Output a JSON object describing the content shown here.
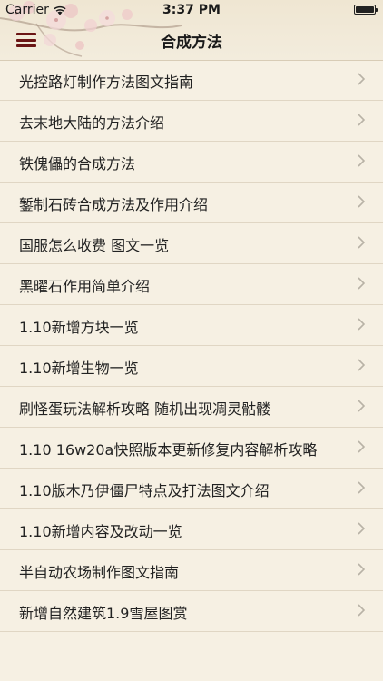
{
  "status_bar": {
    "carrier": "Carrier",
    "time": "3:37 PM"
  },
  "nav": {
    "title": "合成方法",
    "menu_icon": "hamburger-menu-icon"
  },
  "list": {
    "items": [
      {
        "label": "光控路灯制作方法图文指南"
      },
      {
        "label": "去末地大陆的方法介绍"
      },
      {
        "label": "铁傀儡的合成方法"
      },
      {
        "label": "錾制石砖合成方法及作用介绍"
      },
      {
        "label": "国服怎么收费 图文一览"
      },
      {
        "label": "黑曜石作用简单介绍"
      },
      {
        "label": "1.10新增方块一览"
      },
      {
        "label": "1.10新增生物一览"
      },
      {
        "label": "刷怪蛋玩法解析攻略 随机出现凋灵骷髅"
      },
      {
        "label": "1.10 16w20a快照版本更新修复内容解析攻略"
      },
      {
        "label": "1.10版木乃伊僵尸特点及打法图文介绍"
      },
      {
        "label": "1.10新增内容及改动一览"
      },
      {
        "label": "半自动农场制作图文指南"
      },
      {
        "label": "新增自然建筑1.9雪屋图赏"
      }
    ]
  },
  "colors": {
    "background": "#f6f0e3",
    "menu_icon": "#6b1515",
    "separator": "#e0d6c4",
    "chevron": "#b8b2a6"
  }
}
